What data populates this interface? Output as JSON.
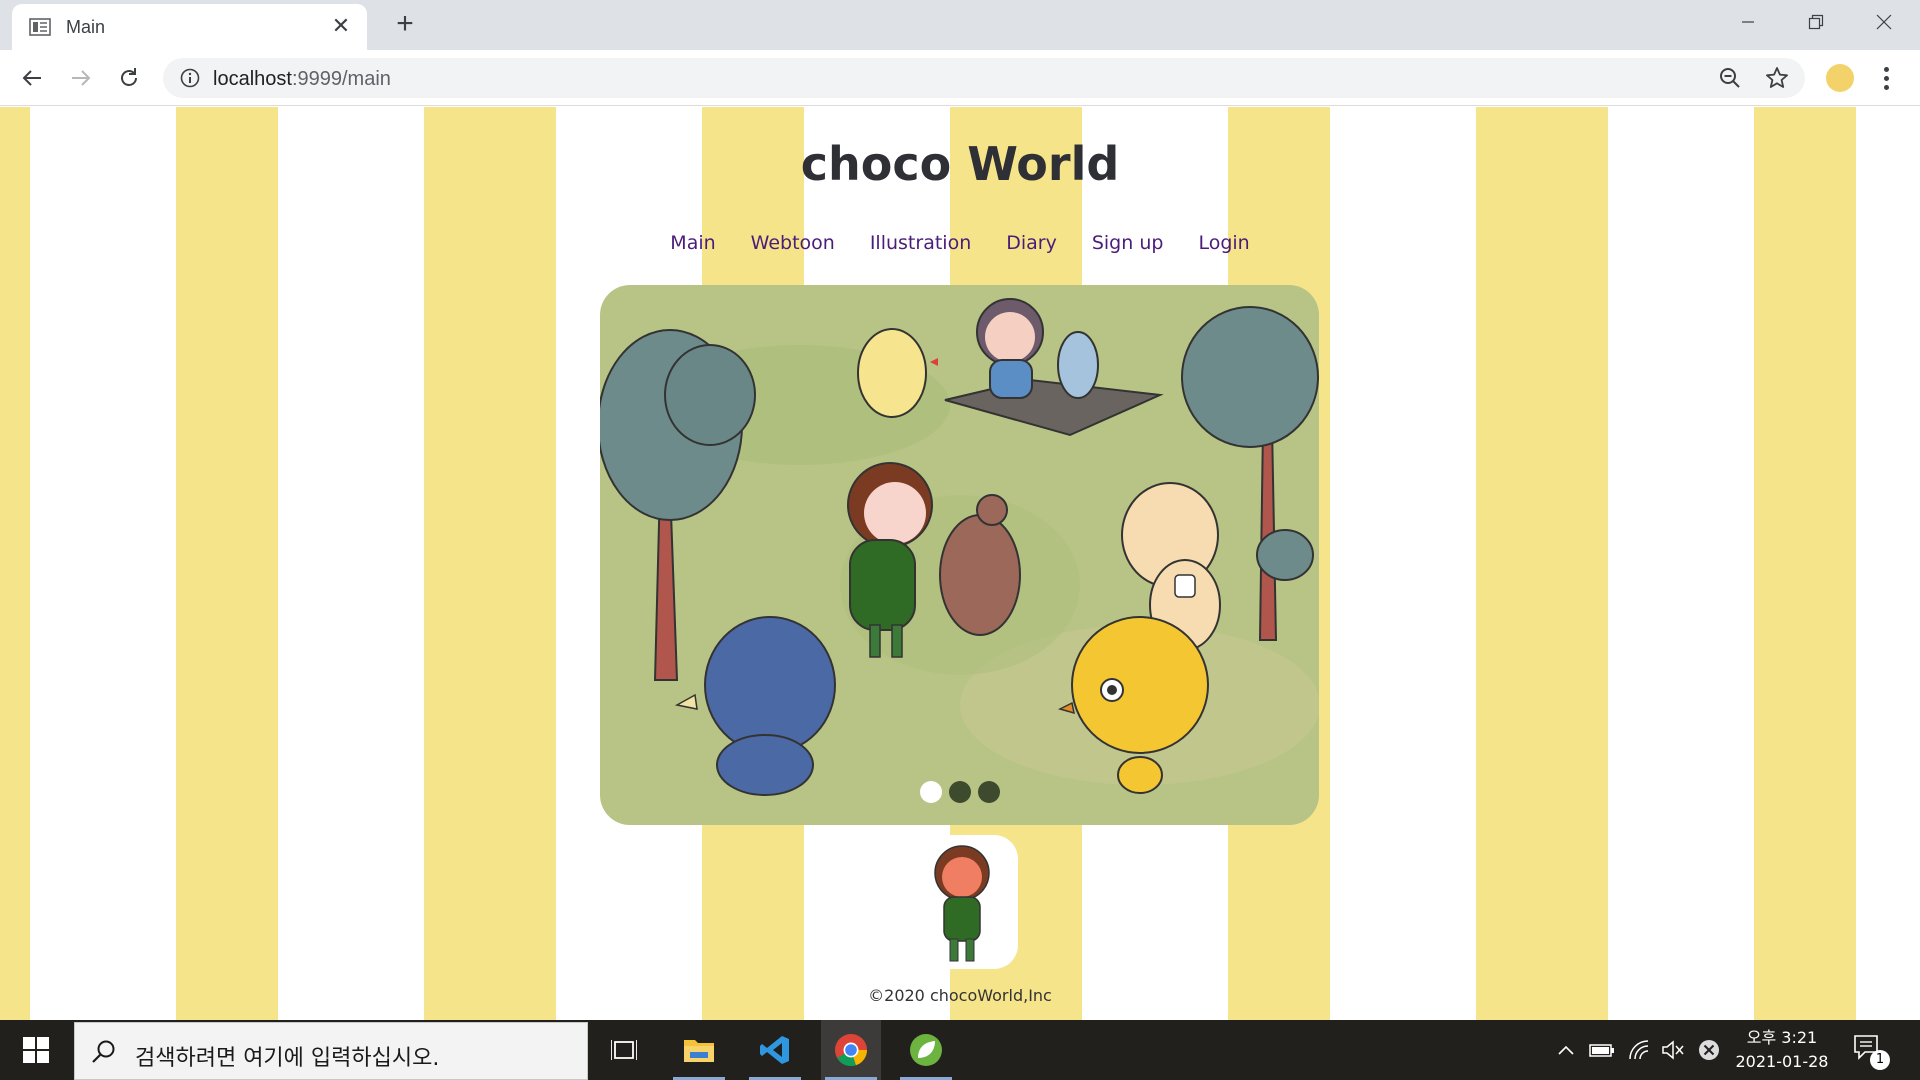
{
  "browser": {
    "tab_title": "Main",
    "url_host": "localhost",
    "url_path": ":9999/main"
  },
  "site": {
    "title": "choco World",
    "nav": [
      "Main",
      "Webtoon",
      "Illustration",
      "Diary",
      "Sign up",
      "Login"
    ],
    "slider": {
      "slide_count": 3,
      "active_slide": 1
    },
    "footer": "©2020 chocoWorld,Inc"
  },
  "taskbar": {
    "search_placeholder": "검색하려면 여기에 입력하십시오.",
    "clock_time": "오후 3:21",
    "clock_date": "2021-01-28",
    "notification_count": "1",
    "pinned_apps": [
      "task-view",
      "file-explorer",
      "vscode",
      "chrome",
      "spring-tool-suite"
    ]
  },
  "colors": {
    "stripe": "#f6e48a",
    "title": "#2f2f36",
    "nav_link": "#4b1d7a",
    "taskbar": "#22201d"
  }
}
